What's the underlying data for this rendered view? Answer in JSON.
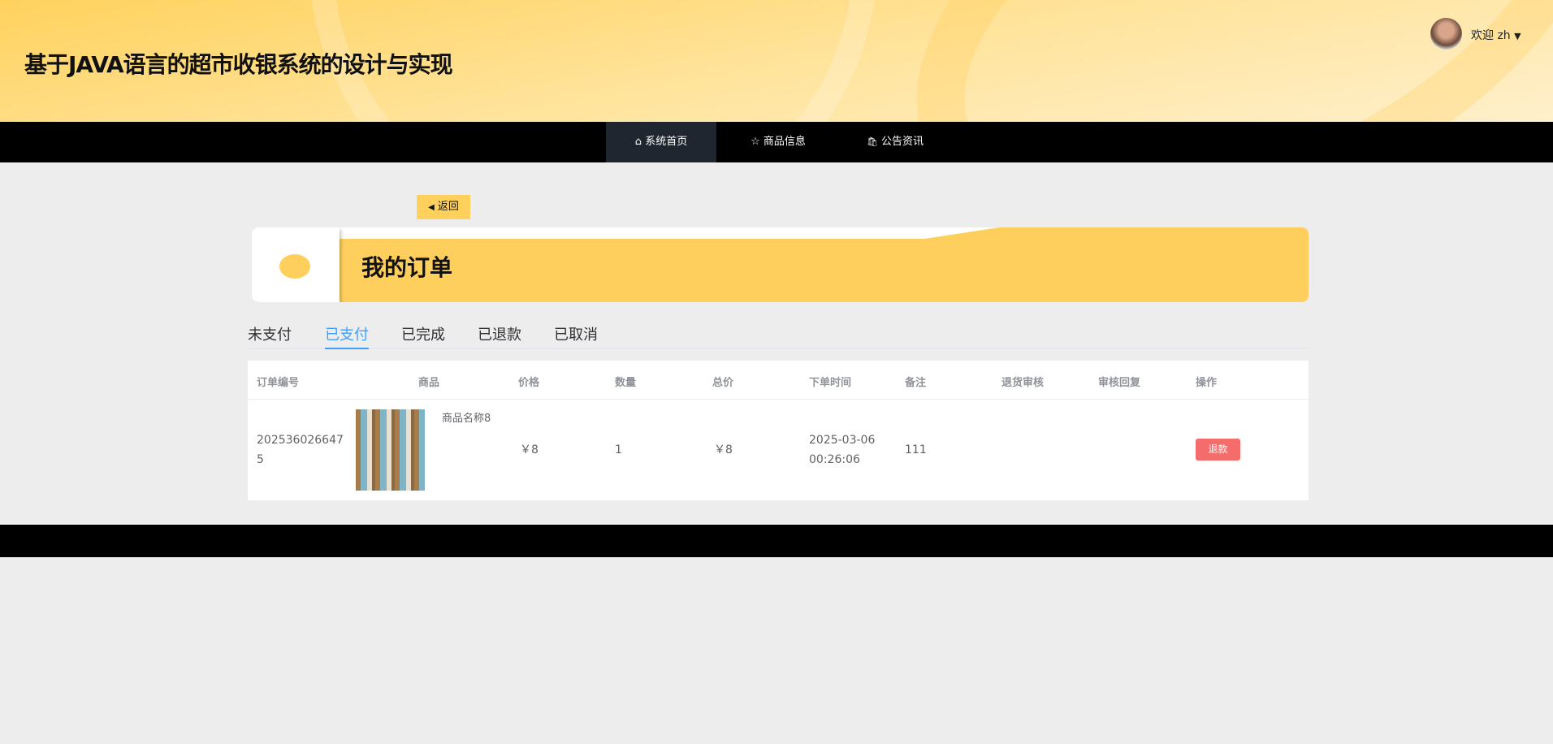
{
  "header": {
    "title": "基于JAVA语言的超市收银系统的设计与实现",
    "welcome": "欢迎 zh",
    "caret": "▼"
  },
  "nav": [
    {
      "icon": "⌂",
      "label": "系统首页"
    },
    {
      "icon": "☆",
      "label": "商品信息"
    },
    {
      "icon": "🛍",
      "label": "公告资讯"
    }
  ],
  "back": {
    "icon": "◀",
    "label": "返回"
  },
  "page_title": "我的订单",
  "tabs": [
    "未支付",
    "已支付",
    "已完成",
    "已退款",
    "已取消"
  ],
  "table": {
    "headers": [
      "订单编号",
      "商品",
      "价格",
      "数量",
      "总价",
      "下单时间",
      "备注",
      "退货审核",
      "审核回复",
      "操作"
    ],
    "rows": [
      {
        "order_no": "2025360266475",
        "product_name": "商品名称8",
        "price": "￥8",
        "quantity": "1",
        "total": "￥8",
        "time": "2025-03-06 00:26:06",
        "remark": "111",
        "return_review": "",
        "review_reply": "",
        "action": "退款"
      }
    ]
  }
}
